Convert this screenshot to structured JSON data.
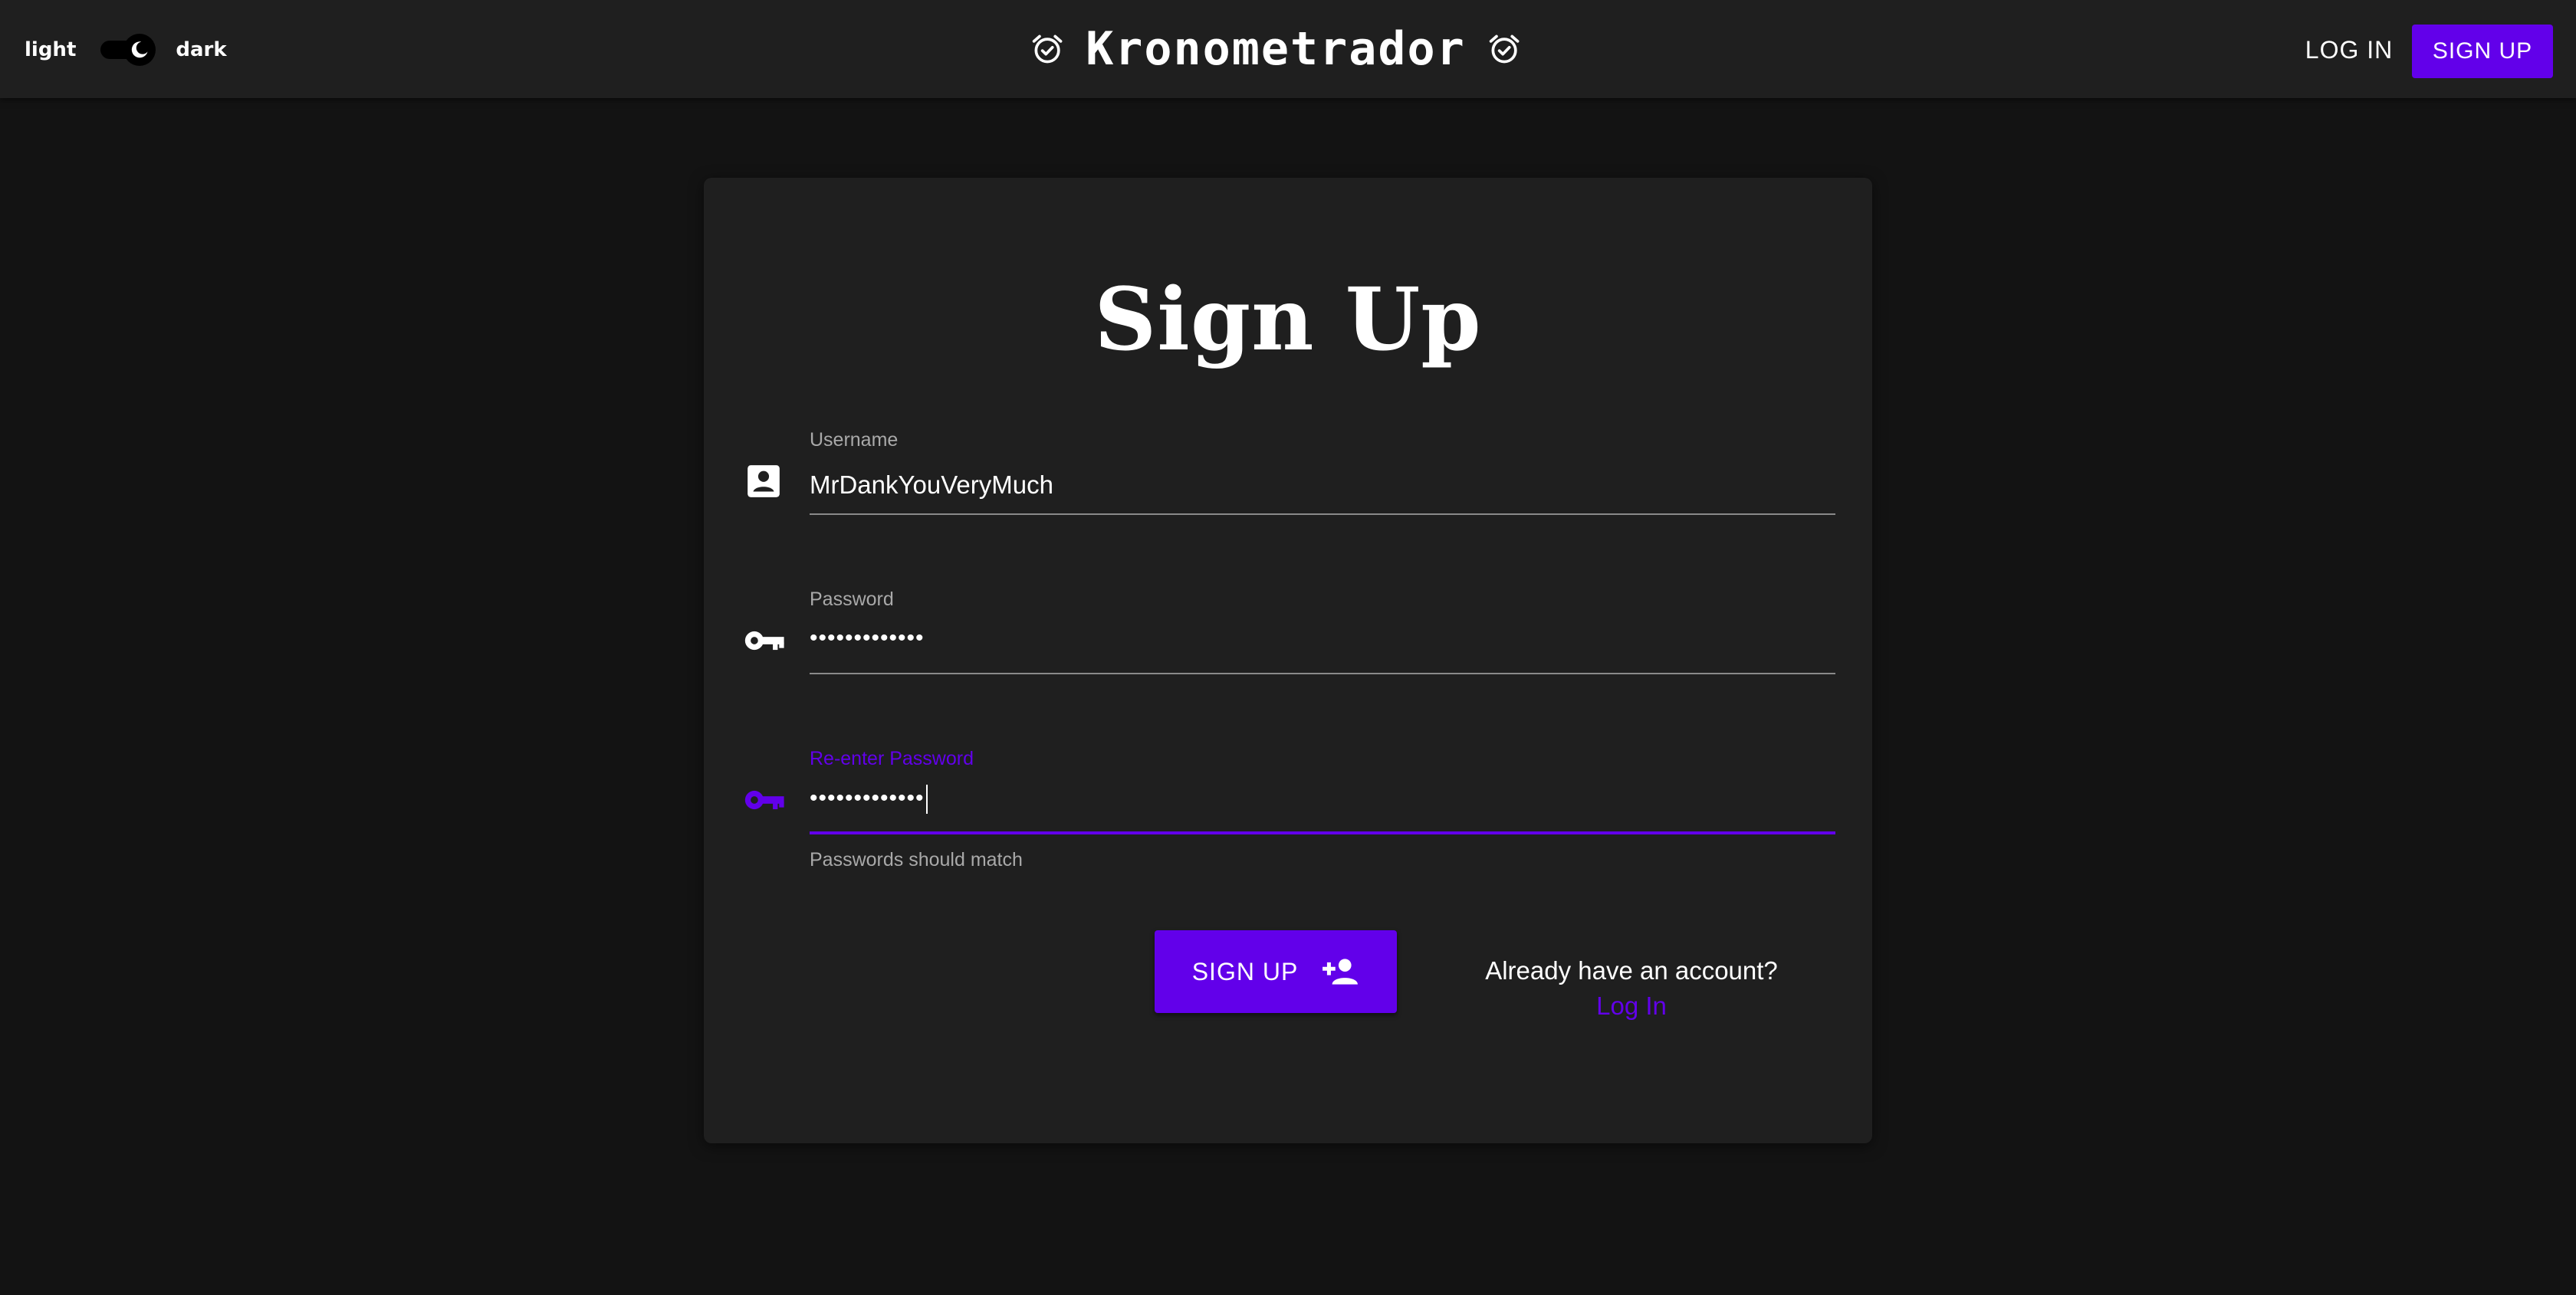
{
  "header": {
    "theme_light_label": "light",
    "theme_dark_label": "dark",
    "app_title": "Kronometrador",
    "login_label": "LOG IN",
    "signup_label": "SIGN UP"
  },
  "form": {
    "title": "Sign Up",
    "username": {
      "label": "Username",
      "value": "MrDankYouVeryMuch"
    },
    "password": {
      "label": "Password",
      "value": "•••••••••••••"
    },
    "reenter_password": {
      "label": "Re-enter Password",
      "value": "•••••••••••••"
    },
    "helper_text": "Passwords should match",
    "submit_label": "SIGN UP",
    "already_text": "Already have an account?",
    "login_link": "Log In"
  },
  "theme": {
    "mode": "dark",
    "accent": "#6200ea",
    "background": "#131313",
    "surface": "#1f1f1f"
  },
  "icons": {
    "title_left": "alarm-on-icon",
    "title_right": "alarm-on-icon",
    "username": "contact-card-icon",
    "password": "key-icon",
    "reenter_password": "key-icon",
    "submit": "person-add-icon",
    "toggle": "moon-icon"
  }
}
